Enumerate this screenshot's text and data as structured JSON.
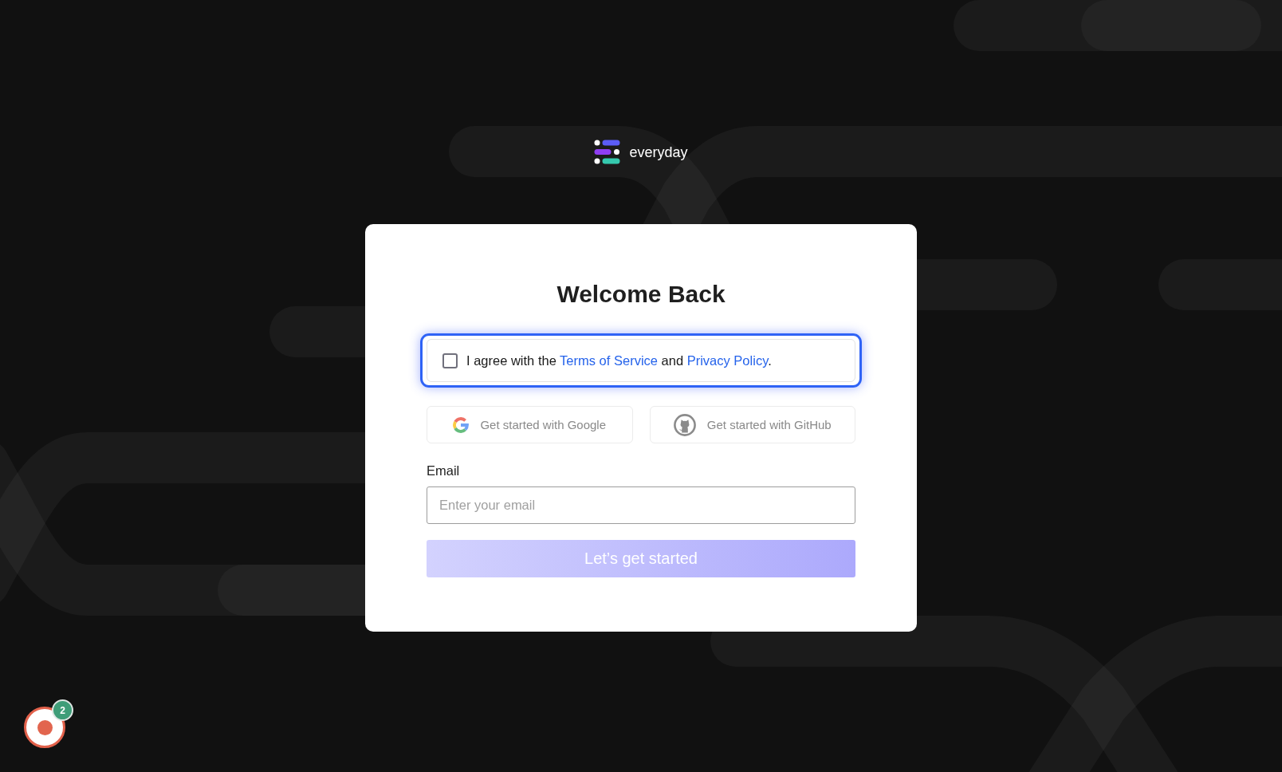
{
  "logo": {
    "name": "everyday"
  },
  "card": {
    "title": "Welcome Back",
    "consent": {
      "checked": false,
      "highlighted": true,
      "parts": [
        {
          "kind": "text",
          "text": "I agree with the "
        },
        {
          "kind": "link",
          "text": "Terms of Service"
        },
        {
          "kind": "text",
          "text": " and "
        },
        {
          "kind": "link",
          "text": "Privacy Policy"
        },
        {
          "kind": "text",
          "text": "."
        }
      ]
    },
    "social_buttons": [
      {
        "kind": "google",
        "label": "Get started with Google",
        "disabled": true
      },
      {
        "kind": "github",
        "label": "Get started with GitHub",
        "disabled": true
      }
    ],
    "email": {
      "label": "Email",
      "placeholder": "Enter your email"
    },
    "submit": {
      "label": "Let’s get started",
      "disabled": true
    }
  },
  "recorder": {
    "badge": "2"
  }
}
